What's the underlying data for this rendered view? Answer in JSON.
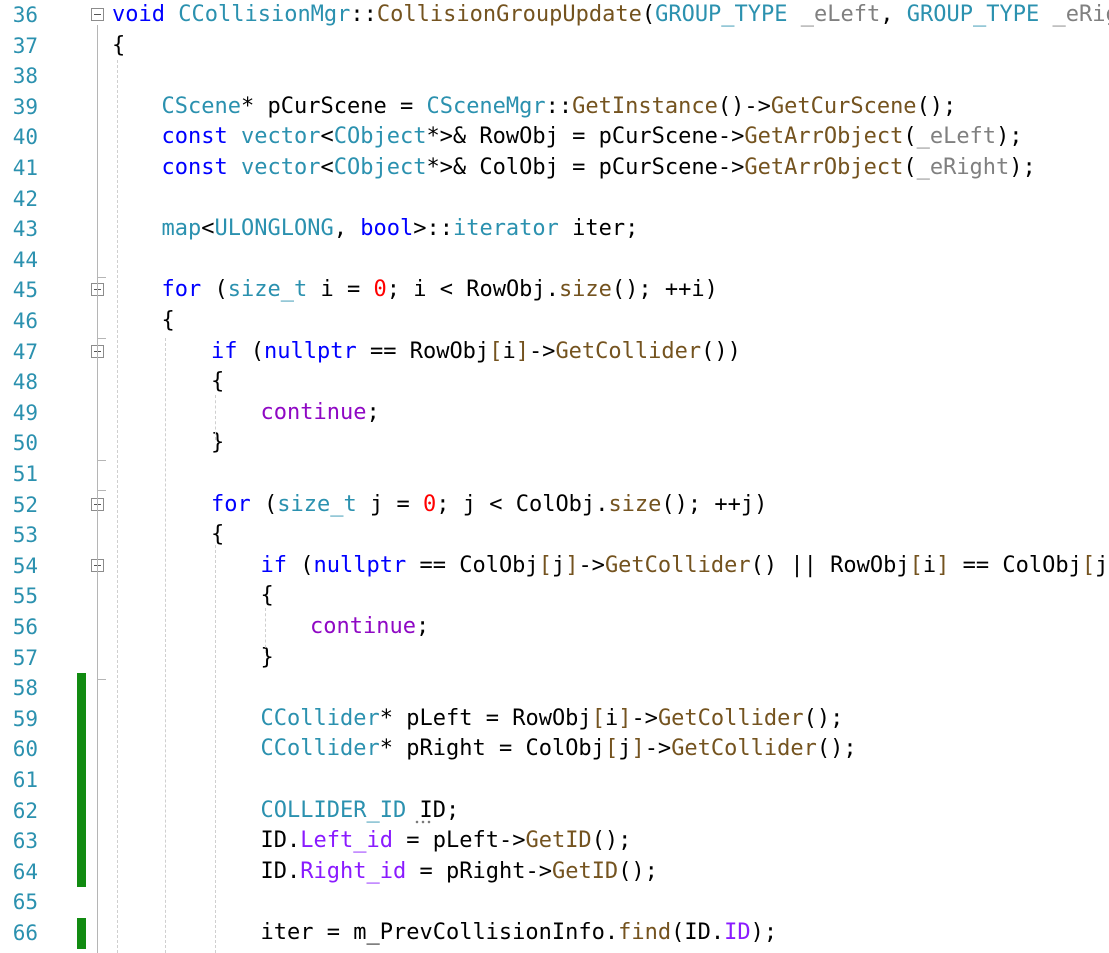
{
  "editor": {
    "lines": [
      {
        "n": "36",
        "fold": true,
        "change": false,
        "indent": 0,
        "tokens": [
          [
            "kw",
            "void"
          ],
          [
            "",
            " "
          ],
          [
            "ty",
            "CCollisionMgr"
          ],
          [
            "",
            "::"
          ],
          [
            "fn",
            "CollisionGroupUpdate"
          ],
          [
            "",
            "("
          ],
          [
            "ty",
            "GROUP_TYPE"
          ],
          [
            "",
            " "
          ],
          [
            "pm",
            "_eLeft"
          ],
          [
            "",
            ", "
          ],
          [
            "ty",
            "GROUP_TYPE"
          ],
          [
            "",
            " "
          ],
          [
            "pm",
            "_eRight"
          ],
          [
            "",
            ")"
          ]
        ]
      },
      {
        "n": "37",
        "fold": false,
        "change": false,
        "indent": 0,
        "tokens": [
          [
            "",
            "{"
          ]
        ]
      },
      {
        "n": "38",
        "fold": false,
        "change": false,
        "indent": 0,
        "tokens": []
      },
      {
        "n": "39",
        "fold": false,
        "change": false,
        "indent": 1,
        "tokens": [
          [
            "ty",
            "CScene"
          ],
          [
            "",
            "* "
          ],
          [
            "",
            "pCurScene"
          ],
          [
            "",
            " = "
          ],
          [
            "ty",
            "CSceneMgr"
          ],
          [
            "",
            "::"
          ],
          [
            "fn",
            "GetInstance"
          ],
          [
            "",
            "()->"
          ],
          [
            "fn",
            "GetCurScene"
          ],
          [
            "",
            "();"
          ]
        ]
      },
      {
        "n": "40",
        "fold": false,
        "change": false,
        "indent": 1,
        "tokens": [
          [
            "kw",
            "const"
          ],
          [
            "",
            " "
          ],
          [
            "ty",
            "vector"
          ],
          [
            "",
            "<"
          ],
          [
            "ty",
            "CObject"
          ],
          [
            "",
            "*>& "
          ],
          [
            "",
            "RowObj"
          ],
          [
            "",
            " = "
          ],
          [
            "",
            "pCurScene"
          ],
          [
            "",
            "->"
          ],
          [
            "fn",
            "GetArrObject"
          ],
          [
            "",
            "("
          ],
          [
            "pm",
            "_eLeft"
          ],
          [
            "",
            ");"
          ]
        ]
      },
      {
        "n": "41",
        "fold": false,
        "change": false,
        "indent": 1,
        "tokens": [
          [
            "kw",
            "const"
          ],
          [
            "",
            " "
          ],
          [
            "ty",
            "vector"
          ],
          [
            "",
            "<"
          ],
          [
            "ty",
            "CObject"
          ],
          [
            "",
            "*>& "
          ],
          [
            "",
            "ColObj"
          ],
          [
            "",
            " = "
          ],
          [
            "",
            "pCurScene"
          ],
          [
            "",
            "->"
          ],
          [
            "fn",
            "GetArrObject"
          ],
          [
            "",
            "("
          ],
          [
            "pm",
            "_eRight"
          ],
          [
            "",
            ");"
          ]
        ]
      },
      {
        "n": "42",
        "fold": false,
        "change": false,
        "indent": 0,
        "tokens": []
      },
      {
        "n": "43",
        "fold": false,
        "change": false,
        "indent": 1,
        "tokens": [
          [
            "ty",
            "map"
          ],
          [
            "",
            "<"
          ],
          [
            "ty",
            "ULONGLONG"
          ],
          [
            "",
            ", "
          ],
          [
            "kw",
            "bool"
          ],
          [
            "",
            ">::"
          ],
          [
            "ty",
            "iterator"
          ],
          [
            "",
            " "
          ],
          [
            "",
            "iter"
          ],
          [
            "",
            ";"
          ]
        ]
      },
      {
        "n": "44",
        "fold": false,
        "change": false,
        "indent": 0,
        "tokens": []
      },
      {
        "n": "45",
        "fold": true,
        "change": false,
        "indent": 1,
        "tokens": [
          [
            "kw",
            "for"
          ],
          [
            "",
            " ("
          ],
          [
            "ty",
            "size_t"
          ],
          [
            "",
            " i = "
          ],
          [
            "nm",
            "0"
          ],
          [
            "",
            "; i < "
          ],
          [
            "",
            "RowObj"
          ],
          [
            "",
            "."
          ],
          [
            "fn",
            "size"
          ],
          [
            "",
            "(); ++i)"
          ]
        ]
      },
      {
        "n": "46",
        "fold": false,
        "change": false,
        "indent": 1,
        "tokens": [
          [
            "",
            "{"
          ]
        ]
      },
      {
        "n": "47",
        "fold": true,
        "change": false,
        "indent": 2,
        "tokens": [
          [
            "kw",
            "if"
          ],
          [
            "",
            " ("
          ],
          [
            "kw",
            "nullptr"
          ],
          [
            "",
            " == "
          ],
          [
            "",
            "RowObj"
          ],
          [
            "fn",
            "["
          ],
          [
            "",
            "i"
          ],
          [
            "fn",
            "]"
          ],
          [
            "",
            "->"
          ],
          [
            "fn",
            "GetCollider"
          ],
          [
            "",
            "())"
          ]
        ]
      },
      {
        "n": "48",
        "fold": false,
        "change": false,
        "indent": 2,
        "tokens": [
          [
            "",
            "{"
          ]
        ]
      },
      {
        "n": "49",
        "fold": false,
        "change": false,
        "indent": 3,
        "tokens": [
          [
            "ct",
            "continue"
          ],
          [
            "",
            ";"
          ]
        ]
      },
      {
        "n": "50",
        "fold": false,
        "change": false,
        "indent": 2,
        "tokens": [
          [
            "",
            "}"
          ]
        ]
      },
      {
        "n": "51",
        "fold": false,
        "change": false,
        "indent": 0,
        "tokens": []
      },
      {
        "n": "52",
        "fold": true,
        "change": false,
        "indent": 2,
        "tokens": [
          [
            "kw",
            "for"
          ],
          [
            "",
            " ("
          ],
          [
            "ty",
            "size_t"
          ],
          [
            "",
            " j = "
          ],
          [
            "nm",
            "0"
          ],
          [
            "",
            "; j < "
          ],
          [
            "",
            "ColObj"
          ],
          [
            "",
            "."
          ],
          [
            "fn",
            "size"
          ],
          [
            "",
            "(); ++j)"
          ]
        ]
      },
      {
        "n": "53",
        "fold": false,
        "change": false,
        "indent": 2,
        "tokens": [
          [
            "",
            "{"
          ]
        ]
      },
      {
        "n": "54",
        "fold": true,
        "change": false,
        "indent": 3,
        "tokens": [
          [
            "kw",
            "if"
          ],
          [
            "",
            " ("
          ],
          [
            "kw",
            "nullptr"
          ],
          [
            "",
            " == "
          ],
          [
            "",
            "ColObj"
          ],
          [
            "fn",
            "["
          ],
          [
            "",
            "j"
          ],
          [
            "fn",
            "]"
          ],
          [
            "",
            "->"
          ],
          [
            "fn",
            "GetCollider"
          ],
          [
            "",
            "() || "
          ],
          [
            "",
            "RowObj"
          ],
          [
            "fn",
            "["
          ],
          [
            "",
            "i"
          ],
          [
            "fn",
            "]"
          ],
          [
            "",
            " == "
          ],
          [
            "",
            "ColObj"
          ],
          [
            "fn",
            "["
          ],
          [
            "",
            "j"
          ],
          [
            "fn",
            "]"
          ],
          [
            "",
            ")"
          ]
        ]
      },
      {
        "n": "55",
        "fold": false,
        "change": false,
        "indent": 3,
        "tokens": [
          [
            "",
            "{"
          ]
        ]
      },
      {
        "n": "56",
        "fold": false,
        "change": false,
        "indent": 4,
        "tokens": [
          [
            "ct",
            "continue"
          ],
          [
            "",
            ";"
          ]
        ]
      },
      {
        "n": "57",
        "fold": false,
        "change": false,
        "indent": 3,
        "tokens": [
          [
            "",
            "}"
          ]
        ]
      },
      {
        "n": "58",
        "fold": false,
        "change": true,
        "indent": 0,
        "tokens": []
      },
      {
        "n": "59",
        "fold": false,
        "change": true,
        "indent": 3,
        "tokens": [
          [
            "ty",
            "CCollider"
          ],
          [
            "",
            "* "
          ],
          [
            "",
            "pLeft"
          ],
          [
            "",
            " = "
          ],
          [
            "",
            "RowObj"
          ],
          [
            "fn",
            "["
          ],
          [
            "",
            "i"
          ],
          [
            "fn",
            "]"
          ],
          [
            "",
            "->"
          ],
          [
            "fn",
            "GetCollider"
          ],
          [
            "",
            "();"
          ]
        ]
      },
      {
        "n": "60",
        "fold": false,
        "change": true,
        "indent": 3,
        "tokens": [
          [
            "ty",
            "CCollider"
          ],
          [
            "",
            "* "
          ],
          [
            "",
            "pRight"
          ],
          [
            "",
            " = "
          ],
          [
            "",
            "ColObj"
          ],
          [
            "fn",
            "["
          ],
          [
            "",
            "j"
          ],
          [
            "fn",
            "]"
          ],
          [
            "",
            "->"
          ],
          [
            "fn",
            "GetCollider"
          ],
          [
            "",
            "();"
          ]
        ]
      },
      {
        "n": "61",
        "fold": false,
        "change": true,
        "indent": 0,
        "tokens": []
      },
      {
        "n": "62",
        "fold": false,
        "change": true,
        "indent": 3,
        "tokens": [
          [
            "ty",
            "COLLIDER_ID"
          ],
          [
            "",
            " "
          ],
          [
            "",
            "ID"
          ],
          [
            "",
            ";"
          ]
        ]
      },
      {
        "n": "63",
        "fold": false,
        "change": true,
        "indent": 3,
        "tokens": [
          [
            "",
            "ID"
          ],
          [
            "",
            "."
          ],
          [
            "mb",
            "Left_id"
          ],
          [
            "",
            " = "
          ],
          [
            "",
            "pLeft"
          ],
          [
            "",
            "->"
          ],
          [
            "fn",
            "GetID"
          ],
          [
            "",
            "();"
          ]
        ]
      },
      {
        "n": "64",
        "fold": false,
        "change": true,
        "indent": 3,
        "tokens": [
          [
            "",
            "ID"
          ],
          [
            "",
            "."
          ],
          [
            "mb",
            "Right_id"
          ],
          [
            "",
            " = "
          ],
          [
            "",
            "pRight"
          ],
          [
            "",
            "->"
          ],
          [
            "fn",
            "GetID"
          ],
          [
            "",
            "();"
          ]
        ]
      },
      {
        "n": "65",
        "fold": false,
        "change": false,
        "indent": 0,
        "tokens": []
      },
      {
        "n": "66",
        "fold": false,
        "change": true,
        "indent": 3,
        "tokens": [
          [
            "",
            "iter"
          ],
          [
            "",
            " = "
          ],
          [
            "",
            "m_PrevCollisionInfo"
          ],
          [
            "",
            "."
          ],
          [
            "fn",
            "find"
          ],
          [
            "",
            "("
          ],
          [
            "",
            "ID"
          ],
          [
            "",
            "."
          ],
          [
            "mb",
            "ID"
          ],
          [
            "",
            ");"
          ]
        ]
      }
    ]
  }
}
